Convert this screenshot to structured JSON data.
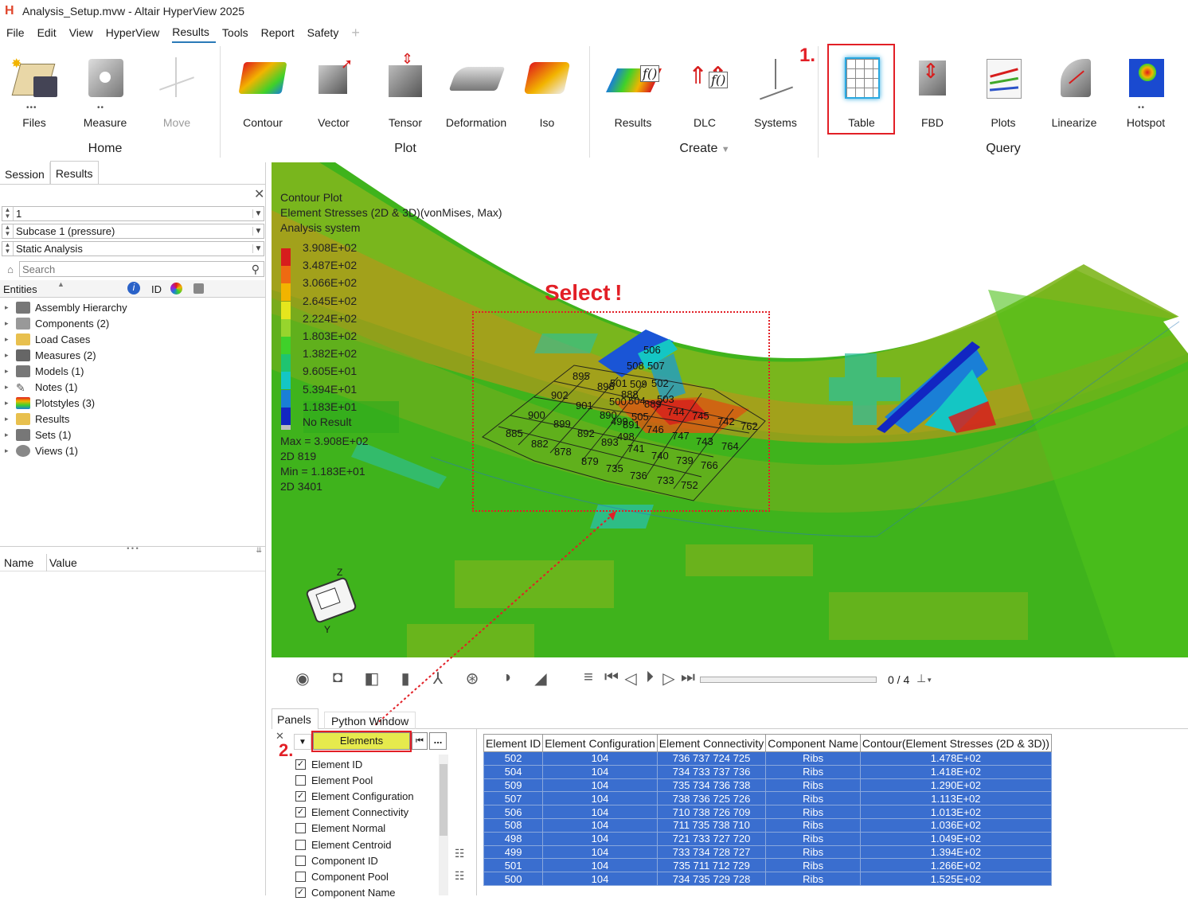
{
  "window": {
    "title": "Analysis_Setup.mvw - Altair HyperView 2025",
    "logo": "H"
  },
  "menu": [
    "File",
    "Edit",
    "View",
    "HyperView",
    "Results",
    "Tools",
    "Report",
    "Safety"
  ],
  "ribbon": {
    "home": {
      "label": "Home",
      "tools": [
        "Files",
        "Measure",
        "Move"
      ]
    },
    "plot": {
      "label": "Plot",
      "tools": [
        "Contour",
        "Vector",
        "Tensor",
        "Deformation",
        "Iso"
      ]
    },
    "create": {
      "label": "Create",
      "tools": [
        "Results",
        "DLC",
        "Systems"
      ]
    },
    "query": {
      "label": "Query",
      "tools": [
        "Table",
        "FBD",
        "Plots",
        "Linearize",
        "Hotspot"
      ]
    }
  },
  "left_panel": {
    "tabs": [
      "Session",
      "Results"
    ],
    "combo1": "1",
    "combo2": "Subcase 1 (pressure)",
    "combo3": "Static Analysis",
    "search_placeholder": "Search",
    "entities_header": "Entities",
    "id_header": "ID",
    "tree": [
      "Assembly Hierarchy",
      "Components (2)",
      "Load Cases",
      "Measures (2)",
      "Models (1)",
      "Notes (1)",
      "Plotstyles (3)",
      "Results",
      "Sets (1)",
      "Views (1)"
    ],
    "props_headers": [
      "Name",
      "Value"
    ]
  },
  "legend": {
    "title1": "Contour Plot",
    "title2": "Element Stresses (2D & 3D)(vonMises, Max)",
    "title3": "Analysis system",
    "values": [
      "3.908E+02",
      "3.487E+02",
      "3.066E+02",
      "2.645E+02",
      "2.224E+02",
      "1.803E+02",
      "1.382E+02",
      "9.605E+01",
      "5.394E+01",
      "1.183E+01"
    ],
    "colors": [
      "#d71d1d",
      "#ee6a12",
      "#f2b400",
      "#e5e61d",
      "#97d52d",
      "#3fd12a",
      "#1fc470",
      "#14c6c4",
      "#1a7fd6",
      "#1226c2"
    ],
    "no_result": "No Result",
    "max_line": "Max =  3.908E+02",
    "max_loc": "2D 819",
    "min_line": "Min =  1.183E+01",
    "min_loc": "2D 3401"
  },
  "element_labels": [
    "506",
    "895",
    "508",
    "507",
    "898",
    "501",
    "509",
    "502",
    "902",
    "888",
    "503",
    "901",
    "500",
    "504",
    "889",
    "900",
    "890",
    "499",
    "505",
    "744",
    "745",
    "742",
    "762",
    "899",
    "891",
    "885",
    "746",
    "892",
    "893",
    "498",
    "747",
    "743",
    "764",
    "882",
    "741",
    "740",
    "878",
    "739",
    "766",
    "879",
    "735",
    "736",
    "733",
    "752"
  ],
  "annotations": {
    "select": "Select !",
    "step1": "1.",
    "step2": "2."
  },
  "animbar": {
    "frame": "0 / 4"
  },
  "bottom": {
    "tabs": [
      "Panels",
      "Python Window"
    ],
    "entity_type": "Elements",
    "more": "...",
    "options": [
      {
        "label": "Element ID",
        "checked": true
      },
      {
        "label": "Element Pool",
        "checked": false
      },
      {
        "label": "Element Configuration",
        "checked": true
      },
      {
        "label": "Element Connectivity",
        "checked": true
      },
      {
        "label": "Element Normal",
        "checked": false
      },
      {
        "label": "Element Centroid",
        "checked": false
      },
      {
        "label": "Component ID",
        "checked": false
      },
      {
        "label": "Component Pool",
        "checked": false
      },
      {
        "label": "Component Name",
        "checked": true
      }
    ],
    "table_headers": [
      "Element ID",
      "Element Configuration",
      "Element Connectivity",
      "Component Name",
      "Contour(Element Stresses (2D & 3D))"
    ],
    "table_rows": [
      [
        "502",
        "104",
        "736 737 724 725",
        "Ribs",
        "1.478E+02"
      ],
      [
        "504",
        "104",
        "734 733 737 736",
        "Ribs",
        "1.418E+02"
      ],
      [
        "509",
        "104",
        "735 734 736 738",
        "Ribs",
        "1.290E+02"
      ],
      [
        "507",
        "104",
        "738 736 725 726",
        "Ribs",
        "1.113E+02"
      ],
      [
        "506",
        "104",
        "710 738 726 709",
        "Ribs",
        "1.013E+02"
      ],
      [
        "508",
        "104",
        "711 735 738 710",
        "Ribs",
        "1.036E+02"
      ],
      [
        "498",
        "104",
        "721 733 727 720",
        "Ribs",
        "1.049E+02"
      ],
      [
        "499",
        "104",
        "733 734 728 727",
        "Ribs",
        "1.394E+02"
      ],
      [
        "501",
        "104",
        "735 711 712 729",
        "Ribs",
        "1.266E+02"
      ],
      [
        "500",
        "104",
        "734 735 729 728",
        "Ribs",
        "1.525E+02"
      ]
    ]
  }
}
